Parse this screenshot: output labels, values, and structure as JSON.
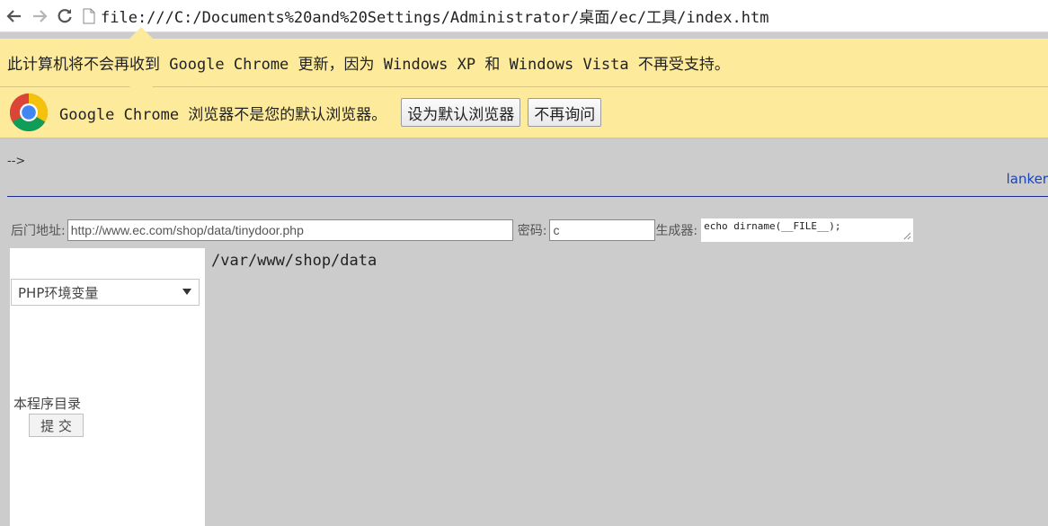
{
  "browser": {
    "url": "file:///C:/Documents%20and%20Settings/Administrator/桌面/ec/工具/index.htm"
  },
  "infobar_xp": {
    "message": "此计算机将不会再收到 Google Chrome 更新，因为 Windows XP 和 Windows Vista 不再受支持。"
  },
  "infobar_default": {
    "message": "Google Chrome 浏览器不是您的默认浏览器。",
    "set_default_label": "设为默认浏览器",
    "dont_ask_label": "不再询问"
  },
  "page": {
    "arrow_text": "-->",
    "lanker_text": "lanker",
    "backdoor_label": "后门地址:",
    "backdoor_value": "http://www.ec.com/shop/data/tinydoor.php",
    "password_label": "密码:",
    "password_value": "c",
    "generator_label": "生成器:",
    "generator_value": "echo dirname(__FILE__);",
    "select_value": "PHP环境变量",
    "dir_label": "本程序目录",
    "submit_label": "提 交",
    "output_text": "/var/www/shop/data"
  }
}
